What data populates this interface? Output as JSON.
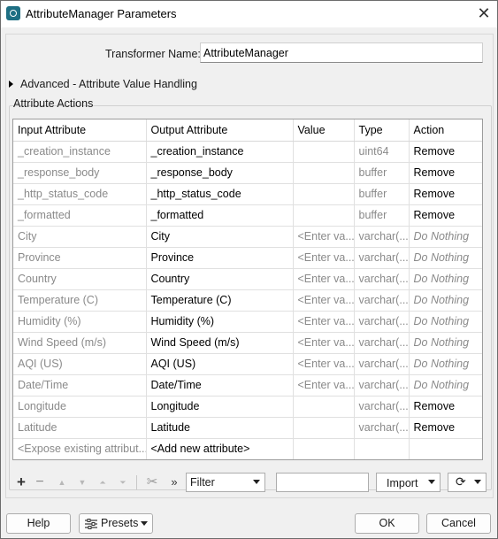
{
  "window": {
    "title": "AttributeManager Parameters"
  },
  "transformer": {
    "label": "Transformer Name:",
    "value": "AttributeManager"
  },
  "advanced": {
    "label": "Advanced - Attribute Value Handling"
  },
  "group": {
    "label": "Attribute Actions"
  },
  "table": {
    "headers": [
      "Input Attribute",
      "Output Attribute",
      "Value",
      "Type",
      "Action"
    ],
    "rows": [
      {
        "input": "_creation_instance",
        "output": "_creation_instance",
        "value": "",
        "type": "uint64",
        "action": "Remove"
      },
      {
        "input": "_response_body",
        "output": "_response_body",
        "value": "",
        "type": "buffer",
        "action": "Remove"
      },
      {
        "input": "_http_status_code",
        "output": "_http_status_code",
        "value": "",
        "type": "buffer",
        "action": "Remove"
      },
      {
        "input": "_formatted",
        "output": "_formatted",
        "value": "",
        "type": "buffer",
        "action": "Remove"
      },
      {
        "input": "City",
        "output": "City",
        "value": "<Enter va...",
        "type": "varchar(...",
        "action": "Do Nothing"
      },
      {
        "input": "Province",
        "output": "Province",
        "value": "<Enter va...",
        "type": "varchar(...",
        "action": "Do Nothing"
      },
      {
        "input": "Country",
        "output": "Country",
        "value": "<Enter va...",
        "type": "varchar(...",
        "action": "Do Nothing"
      },
      {
        "input": "Temperature (C)",
        "output": "Temperature (C)",
        "value": "<Enter va...",
        "type": "varchar(...",
        "action": "Do Nothing"
      },
      {
        "input": "Humidity (%)",
        "output": "Humidity (%)",
        "value": "<Enter va...",
        "type": "varchar(...",
        "action": "Do Nothing"
      },
      {
        "input": "Wind Speed (m/s)",
        "output": "Wind Speed (m/s)",
        "value": "<Enter va...",
        "type": "varchar(...",
        "action": "Do Nothing"
      },
      {
        "input": "AQI (US)",
        "output": "AQI (US)",
        "value": "<Enter va...",
        "type": "varchar(...",
        "action": "Do Nothing"
      },
      {
        "input": "Date/Time",
        "output": "Date/Time",
        "value": "<Enter va...",
        "type": "varchar(...",
        "action": "Do Nothing"
      },
      {
        "input": "Longitude",
        "output": "Longitude",
        "value": "",
        "type": "varchar(...",
        "action": "Remove"
      },
      {
        "input": "Latitude",
        "output": "Latitude",
        "value": "",
        "type": "varchar(...",
        "action": "Remove"
      },
      {
        "input": "<Expose existing attribut...",
        "output": "<Add new attribute>",
        "value": "",
        "type": "",
        "action": ""
      }
    ]
  },
  "toolbar": {
    "add": "+",
    "remove": "−",
    "up": "▲",
    "down": "▼",
    "top": "⏶",
    "bottom": "⏷",
    "cut": "✂",
    "more": "»",
    "filter_label": "Filter",
    "filter_value": "",
    "import_label": "Import",
    "refresh": "⟳"
  },
  "footer": {
    "help": "Help",
    "presets": "Presets",
    "ok": "OK",
    "cancel": "Cancel"
  },
  "colors": {
    "icon": "#1e6f83",
    "muted": "#8a8a8a"
  }
}
